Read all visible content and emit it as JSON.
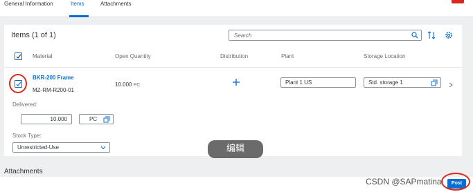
{
  "tabs": [
    {
      "label": "General Information",
      "active": false
    },
    {
      "label": "Items",
      "active": true
    },
    {
      "label": "Attachments",
      "active": false
    }
  ],
  "items_panel": {
    "title": "Items (1 of 1)",
    "search_placeholder": "Search",
    "toolbar_icons": [
      "sort-icon",
      "settings-icon"
    ],
    "columns": [
      "Material",
      "Open Quantity",
      "Distribution",
      "Plant",
      "Storage Location"
    ],
    "row": {
      "selected": true,
      "material_title": "BKR-200 Frame",
      "material_id": "MZ-RM-R200-01",
      "open_quantity": "10.000",
      "open_quantity_unit": "PC",
      "plant": "Plant 1 US",
      "storage_location": "Std. storage 1"
    },
    "delivered": {
      "label": "Delivered:",
      "quantity": "10.000",
      "unit": "PC"
    },
    "stock_type": {
      "label": "Stock Type:",
      "value": "Unrestricted-Use"
    }
  },
  "toast": "编辑",
  "attachments_heading": "Attachments",
  "footer": {
    "watermark": "CSDN @SAPmatinal",
    "post_button": "Post"
  },
  "colors": {
    "accent": "#0a6ed1",
    "highlight_circle": "#e0261d",
    "background": "#edeff0"
  }
}
